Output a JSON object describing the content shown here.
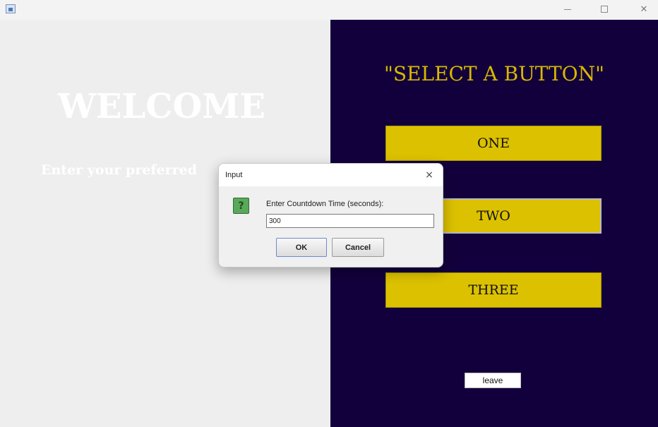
{
  "window": {
    "icon": "java-app-icon",
    "controls": {
      "minimize": "minimize-icon",
      "maximize": "maximize-icon",
      "close": "close-icon"
    }
  },
  "left_panel": {
    "welcome": "WELCOME",
    "prompt": "Enter your preferred"
  },
  "right_panel": {
    "title": "\"SELECT A BUTTON\"",
    "buttons": [
      "ONE",
      "TWO",
      "THREE"
    ],
    "leave_label": "leave"
  },
  "dialog": {
    "title": "Input",
    "close_glyph": "×",
    "icon": "question-icon",
    "icon_glyph": "?",
    "label": "Enter Countdown Time (seconds):",
    "input_value": "300",
    "ok_label": "OK",
    "cancel_label": "Cancel"
  },
  "colors": {
    "panel_bg": "#12003c",
    "button_yellow": "#dcc100",
    "title_yellow": "#d8b800"
  }
}
